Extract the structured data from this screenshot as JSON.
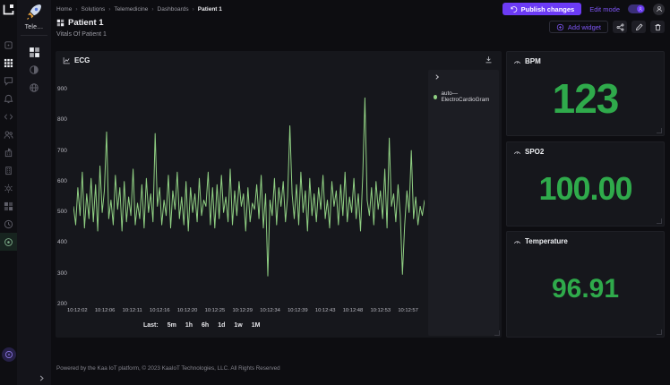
{
  "colors": {
    "accent": "#6c3bf6",
    "accent_text": "#7d55f3",
    "value_green": "#2faa4b",
    "chart_green": "#90d083",
    "panel_bg": "#16171c"
  },
  "sidebar": {
    "brand_short": "Tele…",
    "rail1_icons": [
      "apps-icon",
      "solutions-grid-icon",
      "chat-icon",
      "notifications-bell-icon",
      "code-icon",
      "users-icon",
      "organization-icon",
      "building-icon",
      "settings-gear-icon",
      "widgets-icon",
      "history-clock-icon",
      "target-icon",
      "help-circle-icon"
    ],
    "rail2_icons": [
      "rocket-logo",
      "dashboards-icon",
      "theme-contrast-icon",
      "globe-icon",
      "collapse-chevron"
    ]
  },
  "topbar": {
    "breadcrumbs": [
      "Home",
      "Solutions",
      "Telemedicine",
      "Dashboards",
      "Patient 1"
    ],
    "separator": "›",
    "publish_label": "Publish changes",
    "edit_mode_label": "Edit mode",
    "edit_mode_on": true
  },
  "header": {
    "title": "Patient 1",
    "subtitle": "Vitals Of Patient 1",
    "add_widget_label": "Add widget"
  },
  "chart_data": {
    "type": "line",
    "title": "ECG",
    "legend_position": "right",
    "grid": false,
    "ylim": [
      200,
      900
    ],
    "y_ticks": [
      "900",
      "800",
      "700",
      "600",
      "500",
      "400",
      "300",
      "200"
    ],
    "x_ticks": [
      "10:12:02",
      "10:12:06",
      "10:12:11",
      "10:12:16",
      "10:12:20",
      "10:12:25",
      "10:12:29",
      "10:12:34",
      "10:12:39",
      "10:12:43",
      "10:12:48",
      "10:12:53",
      "10:12:57"
    ],
    "series": [
      {
        "name": "auto—ElectroCardioGram",
        "color": "#90d083",
        "values": [
          520,
          460,
          580,
          490,
          630,
          450,
          560,
          480,
          610,
          470,
          590,
          440,
          650,
          500,
          570,
          760,
          480,
          540,
          460,
          620,
          510,
          580,
          440,
          600,
          470,
          550,
          490,
          640,
          460,
          530,
          480,
          590,
          450,
          610,
          500,
          560,
          470,
          755,
          520,
          580,
          460,
          540,
          490,
          620,
          450,
          570,
          510,
          630,
          480,
          550,
          460,
          600,
          440,
          580,
          500,
          560,
          470,
          610,
          490,
          540,
          520,
          630,
          460,
          580,
          450,
          590,
          480,
          620,
          500,
          550,
          470,
          640,
          460,
          570,
          490,
          600,
          520,
          560,
          440,
          580,
          470,
          530,
          510,
          590,
          480,
          620,
          450,
          560,
          295,
          540,
          490,
          610,
          460,
          580,
          520,
          600,
          470,
          550,
          780,
          560,
          480,
          590,
          460,
          630,
          500,
          570,
          440,
          610,
          490,
          560,
          470,
          580,
          510,
          620,
          480,
          540,
          450,
          600,
          520,
          570,
          460,
          590,
          490,
          630,
          470,
          550,
          500,
          610,
          480,
          560,
          440,
          620,
          870,
          540,
          490,
          580,
          460,
          600,
          510,
          570,
          480,
          640,
          450,
          740,
          520,
          560,
          470,
          590,
          490,
          300,
          460,
          570,
          500,
          700,
          480,
          550,
          460,
          520,
          490,
          540
        ]
      }
    ]
  },
  "quick_ranges": {
    "label": "Last:",
    "options": [
      "5m",
      "1h",
      "6h",
      "1d",
      "1w",
      "1M"
    ]
  },
  "stats": [
    {
      "title": "BPM",
      "value": "123"
    },
    {
      "title": "SPO2",
      "value": "100.00"
    },
    {
      "title": "Temperature",
      "value": "96.91"
    }
  ],
  "footer": {
    "text": "Powered by the Kaa IoT platform, © 2023 KaaIoT Technologies, LLC. All Rights Reserved"
  }
}
